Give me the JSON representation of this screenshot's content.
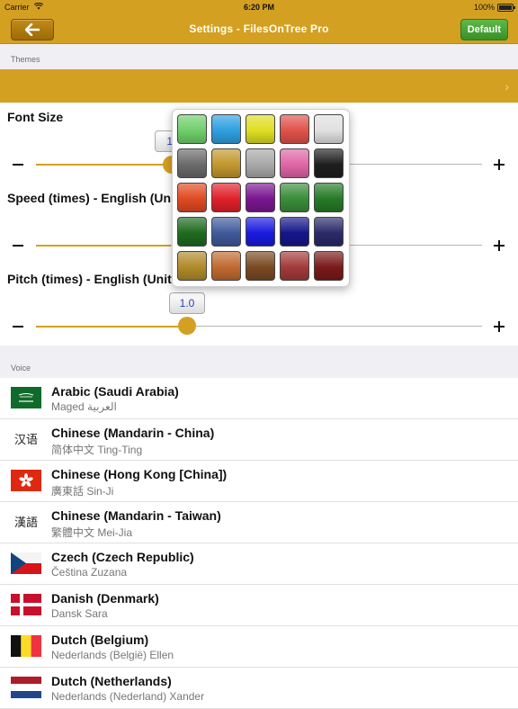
{
  "status_bar": {
    "carrier": "Carrier",
    "time": "6:20 PM",
    "battery": "100%"
  },
  "nav": {
    "title": "Settings - FilesOnTree Pro",
    "default_label": "Default"
  },
  "themes": {
    "header": "Themes"
  },
  "sliders": {
    "font_size": {
      "label": "Font Size",
      "value_label": "10"
    },
    "speed": {
      "label": "Speed (times) - English (United States)"
    },
    "pitch": {
      "label": "Pitch (times) - English (United States)",
      "value_label": "1.0"
    }
  },
  "voice": {
    "header": "Voice",
    "items": [
      {
        "name": "Arabic (Saudi Arabia)",
        "sub": "Maged العربية",
        "flag": "saudi-arabia-flag"
      },
      {
        "name": "Chinese (Mandarin - China)",
        "sub": "简体中文 Ting-Ting",
        "flag_text": "汉语",
        "flag": "chinese-simplified-glyph"
      },
      {
        "name": "Chinese (Hong Kong [China])",
        "sub": "廣東話 Sin-Ji",
        "flag": "hong-kong-flag"
      },
      {
        "name": "Chinese (Mandarin - Taiwan)",
        "sub": "繁體中文 Mei-Jia",
        "flag_text": "漢語",
        "flag": "chinese-traditional-glyph"
      },
      {
        "name": "Czech (Czech Republic)",
        "sub": "Čeština Zuzana",
        "flag": "czech-flag"
      },
      {
        "name": "Danish (Denmark)",
        "sub": "Dansk Sara",
        "flag": "denmark-flag"
      },
      {
        "name": "Dutch (Belgium)",
        "sub": "Nederlands (België) Ellen",
        "flag": "belgium-flag"
      },
      {
        "name": "Dutch (Netherlands)",
        "sub": "Nederlands (Nederland) Xander",
        "flag": "netherlands-flag"
      }
    ]
  },
  "palette": {
    "colors": [
      "#6fcf6a",
      "#2f9fe0",
      "#dede22",
      "#e0524a",
      "#e0e0e0",
      "#6a6a6a",
      "#c2972e",
      "#a8a8a8",
      "#e065a5",
      "#1e1e1e",
      "#e04a22",
      "#e0202a",
      "#7a1690",
      "#3a8c3a",
      "#267a26",
      "#1f6a1f",
      "#3f5a9a",
      "#1a1ae0",
      "#16168a",
      "#2a2a6a",
      "#b08a2a",
      "#c06a30",
      "#7a4a22",
      "#a33a3a",
      "#7a1a1a"
    ]
  }
}
